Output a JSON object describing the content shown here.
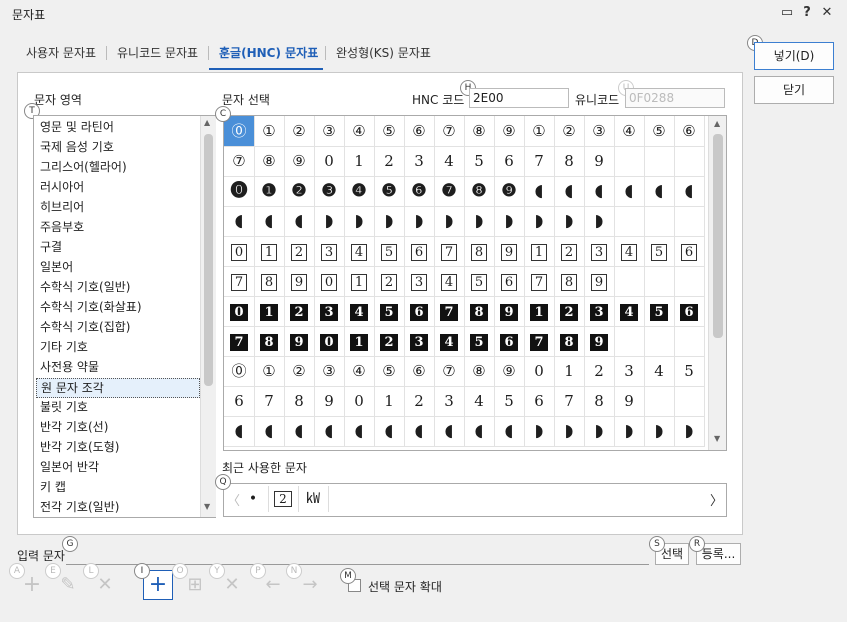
{
  "window": {
    "title": "문자표"
  },
  "titlebar_icons": [
    "chat-icon",
    "help-icon",
    "close-icon"
  ],
  "titlebar_glyphs": {
    "chat": "▭",
    "help": "?",
    "close": "✕"
  },
  "tabs": [
    {
      "label": "사용자 문자표",
      "active": false
    },
    {
      "label": "유니코드 문자표",
      "active": false
    },
    {
      "label": "훈글(HNC) 문자표",
      "active": true
    },
    {
      "label": "완성형(KS) 문자표",
      "active": false
    }
  ],
  "buttons": {
    "insert": "넣기(D)",
    "close": "닫기",
    "select": "선택",
    "register": "등록..."
  },
  "badges": {
    "insert": "D",
    "area": "T",
    "hnc": "H",
    "unicode": "U",
    "grid": "C",
    "recent": "Q",
    "input": "G",
    "select": "S",
    "register": "R",
    "zoom": "M",
    "t_a": "A",
    "t_e": "E",
    "t_l": "L",
    "t_i": "I",
    "t_o": "O",
    "t_y": "Y",
    "t_p": "P",
    "t_n": "N"
  },
  "area": {
    "label": "문자 영역",
    "items": [
      "영문 및 라틴어",
      "국제 음성 기호",
      "그리스어(헬라어)",
      "러시아어",
      "히브리어",
      "주음부호",
      "구결",
      "일본어",
      "수학식 기호(일반)",
      "수학식 기호(화살표)",
      "수학식 기호(집합)",
      "기타 기호",
      "사전용 약물",
      "원 문자 조각",
      "불릿 기호",
      "반각 기호(선)",
      "반각 기호(도형)",
      "일본어 반각",
      "키 캡",
      "전각 기호(일반)"
    ],
    "selected_index": 13
  },
  "char_select": {
    "label": "문자 선택",
    "hnc_label": "HNC 코드",
    "hnc_value": "2E00",
    "unicode_label": "유니코드",
    "unicode_value": "0F0288",
    "rows": [
      [
        "⓪",
        "①",
        "②",
        "③",
        "④",
        "⑤",
        "⑥",
        "⑦",
        "⑧",
        "⑨",
        "①",
        "②",
        "③",
        "④",
        "⑤",
        "⑥"
      ],
      [
        "⑦",
        "⑧",
        "⑨",
        "0",
        "1",
        "2",
        "3",
        "4",
        "5",
        "6",
        "7",
        "8",
        "9",
        "",
        "",
        ""
      ],
      [
        "⓿",
        "❶",
        "❷",
        "❸",
        "❹",
        "❺",
        "❻",
        "❼",
        "❽",
        "❾",
        "◖",
        "◖",
        "◖",
        "◖",
        "◖",
        "◖"
      ],
      [
        "◖",
        "◖",
        "◖",
        "◗",
        "◗",
        "◗",
        "◗",
        "◗",
        "◗",
        "◗",
        "◗",
        "◗",
        "◗",
        "",
        "",
        ""
      ],
      [
        "0",
        "1",
        "2",
        "3",
        "4",
        "5",
        "6",
        "7",
        "8",
        "9",
        "1",
        "2",
        "3",
        "4",
        "5",
        "6"
      ],
      [
        "7",
        "8",
        "9",
        "0",
        "1",
        "2",
        "3",
        "4",
        "5",
        "6",
        "7",
        "8",
        "9",
        "",
        "",
        ""
      ],
      [
        "0",
        "1",
        "2",
        "3",
        "4",
        "5",
        "6",
        "7",
        "8",
        "9",
        "1",
        "2",
        "3",
        "4",
        "5",
        "6"
      ],
      [
        "7",
        "8",
        "9",
        "0",
        "1",
        "2",
        "3",
        "4",
        "5",
        "6",
        "7",
        "8",
        "9",
        "",
        "",
        ""
      ],
      [
        "⓪",
        "①",
        "②",
        "③",
        "④",
        "⑤",
        "⑥",
        "⑦",
        "⑧",
        "⑨",
        "0",
        "1",
        "2",
        "3",
        "4",
        "5"
      ],
      [
        "6",
        "7",
        "8",
        "9",
        "0",
        "1",
        "2",
        "3",
        "4",
        "5",
        "6",
        "7",
        "8",
        "9",
        "",
        ""
      ],
      [
        "◖",
        "◖",
        "◖",
        "◖",
        "◖",
        "◖",
        "◖",
        "◖",
        "◖",
        "◖",
        "◗",
        "◗",
        "◗",
        "◗",
        "◗",
        "◗"
      ]
    ],
    "row_styles": [
      "circle",
      "circle",
      "neg",
      "neg",
      "box",
      "box",
      "inv",
      "inv",
      "circle",
      "plain",
      "neg"
    ],
    "selected_cell": [
      0,
      0
    ]
  },
  "recent": {
    "label": "최근 사용한 문자",
    "chars": [
      "•",
      "2",
      "㎾"
    ],
    "prev": "〈",
    "next": "〉"
  },
  "input": {
    "label": "입력 문자",
    "value": ""
  },
  "toolbar": [
    "add-grey-icon",
    "edit-icon",
    "delete-multi-icon",
    "add-icon",
    "add-table-icon",
    "delete-icon",
    "arrow-left-icon",
    "arrow-right-icon"
  ],
  "toolbar_glyphs": {
    "add": "+",
    "edit": "✎",
    "multi": "✕",
    "table": "⊞",
    "del": "✕",
    "left": "←",
    "right": "→"
  },
  "zoom": {
    "label": "선택 문자 확대",
    "checked": false
  },
  "colors": {
    "accent": "#1f5fb7",
    "selected": "#4a8fd8",
    "selected_bg": "#e5f0fb"
  }
}
